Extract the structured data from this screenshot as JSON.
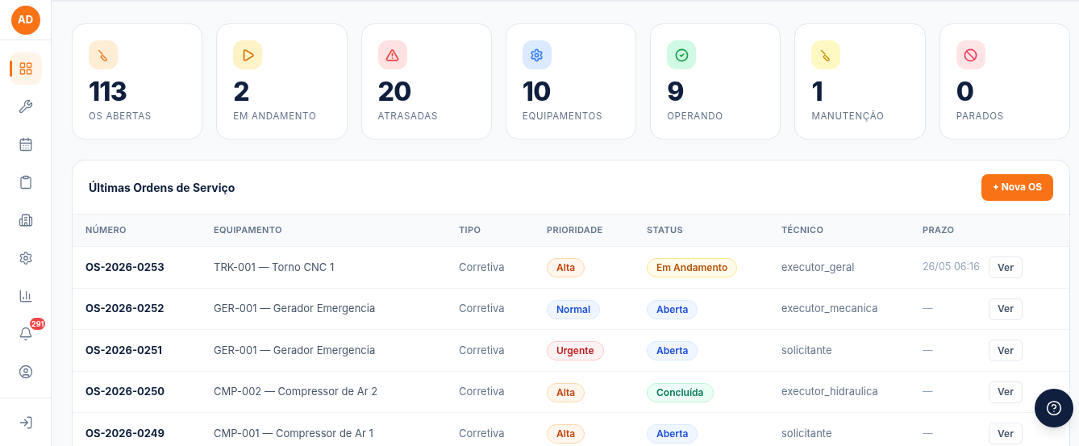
{
  "sidebar": {
    "avatar": "AD",
    "items": [
      {
        "selected": true
      },
      {
        "selected": false
      },
      {
        "selected": false
      },
      {
        "selected": false
      },
      {
        "selected": false
      },
      {
        "selected": false
      },
      {
        "selected": false
      },
      {
        "selected": false,
        "badge": "291"
      },
      {
        "selected": false
      }
    ]
  },
  "stats": [
    {
      "value": "113",
      "label": "OS ABERTAS",
      "color": "#f97316"
    },
    {
      "value": "2",
      "label": "EM ANDAMENTO",
      "color": "#d97706"
    },
    {
      "value": "20",
      "label": "ATRASADAS",
      "color": "#ef4444"
    },
    {
      "value": "10",
      "label": "EQUIPAMENTOS",
      "color": "#3b82f6"
    },
    {
      "value": "9",
      "label": "OPERANDO",
      "color": "#16a34a"
    },
    {
      "value": "1",
      "label": "MANUTENÇÃO",
      "color": "#ca8a04"
    },
    {
      "value": "0",
      "label": "PARADOS",
      "color": "#f43f5e"
    }
  ],
  "orders": {
    "title": "Últimas Ordens de Serviço",
    "new_button": "+ Nova OS",
    "columns": [
      "NÚMERO",
      "EQUIPAMENTO",
      "TIPO",
      "PRIORIDADE",
      "STATUS",
      "TÉCNICO",
      "PRAZO"
    ],
    "rows": [
      {
        "number": "OS-2026-0253",
        "equipment": "TRK-001 — Torno CNC 1",
        "type": "Corretiva",
        "priority": {
          "text": "Alta",
          "color": "#c2410c"
        },
        "status": {
          "text": "Em Andamento",
          "color": "#b45309"
        },
        "technician": "executor_geral",
        "deadline": "26/05 06:16",
        "action": "Ver"
      },
      {
        "number": "OS-2026-0252",
        "equipment": "GER-001 — Gerador Emergencia",
        "type": "Corretiva",
        "priority": {
          "text": "Normal",
          "color": "#1d4ed8"
        },
        "status": {
          "text": "Aberta",
          "color": "#1d4ed8"
        },
        "technician": "executor_mecanica",
        "deadline": "—",
        "action": "Ver"
      },
      {
        "number": "OS-2026-0251",
        "equipment": "GER-001 — Gerador Emergencia",
        "type": "Corretiva",
        "priority": {
          "text": "Urgente",
          "color": "#b91c1c"
        },
        "status": {
          "text": "Aberta",
          "color": "#1d4ed8"
        },
        "technician": "solicitante",
        "deadline": "—",
        "action": "Ver"
      },
      {
        "number": "OS-2026-0250",
        "equipment": "CMP-002 — Compressor de Ar 2",
        "type": "Corretiva",
        "priority": {
          "text": "Alta",
          "color": "#c2410c"
        },
        "status": {
          "text": "Concluída",
          "color": "#047857"
        },
        "technician": "executor_hidraulica",
        "deadline": "—",
        "action": "Ver"
      },
      {
        "number": "OS-2026-0249",
        "equipment": "CMP-001 — Compressor de Ar 1",
        "type": "Corretiva",
        "priority": {
          "text": "Alta",
          "color": "#c2410c"
        },
        "status": {
          "text": "Aberta",
          "color": "#1d4ed8"
        },
        "technician": "solicitante",
        "deadline": "—",
        "action": "Ver"
      }
    ]
  }
}
